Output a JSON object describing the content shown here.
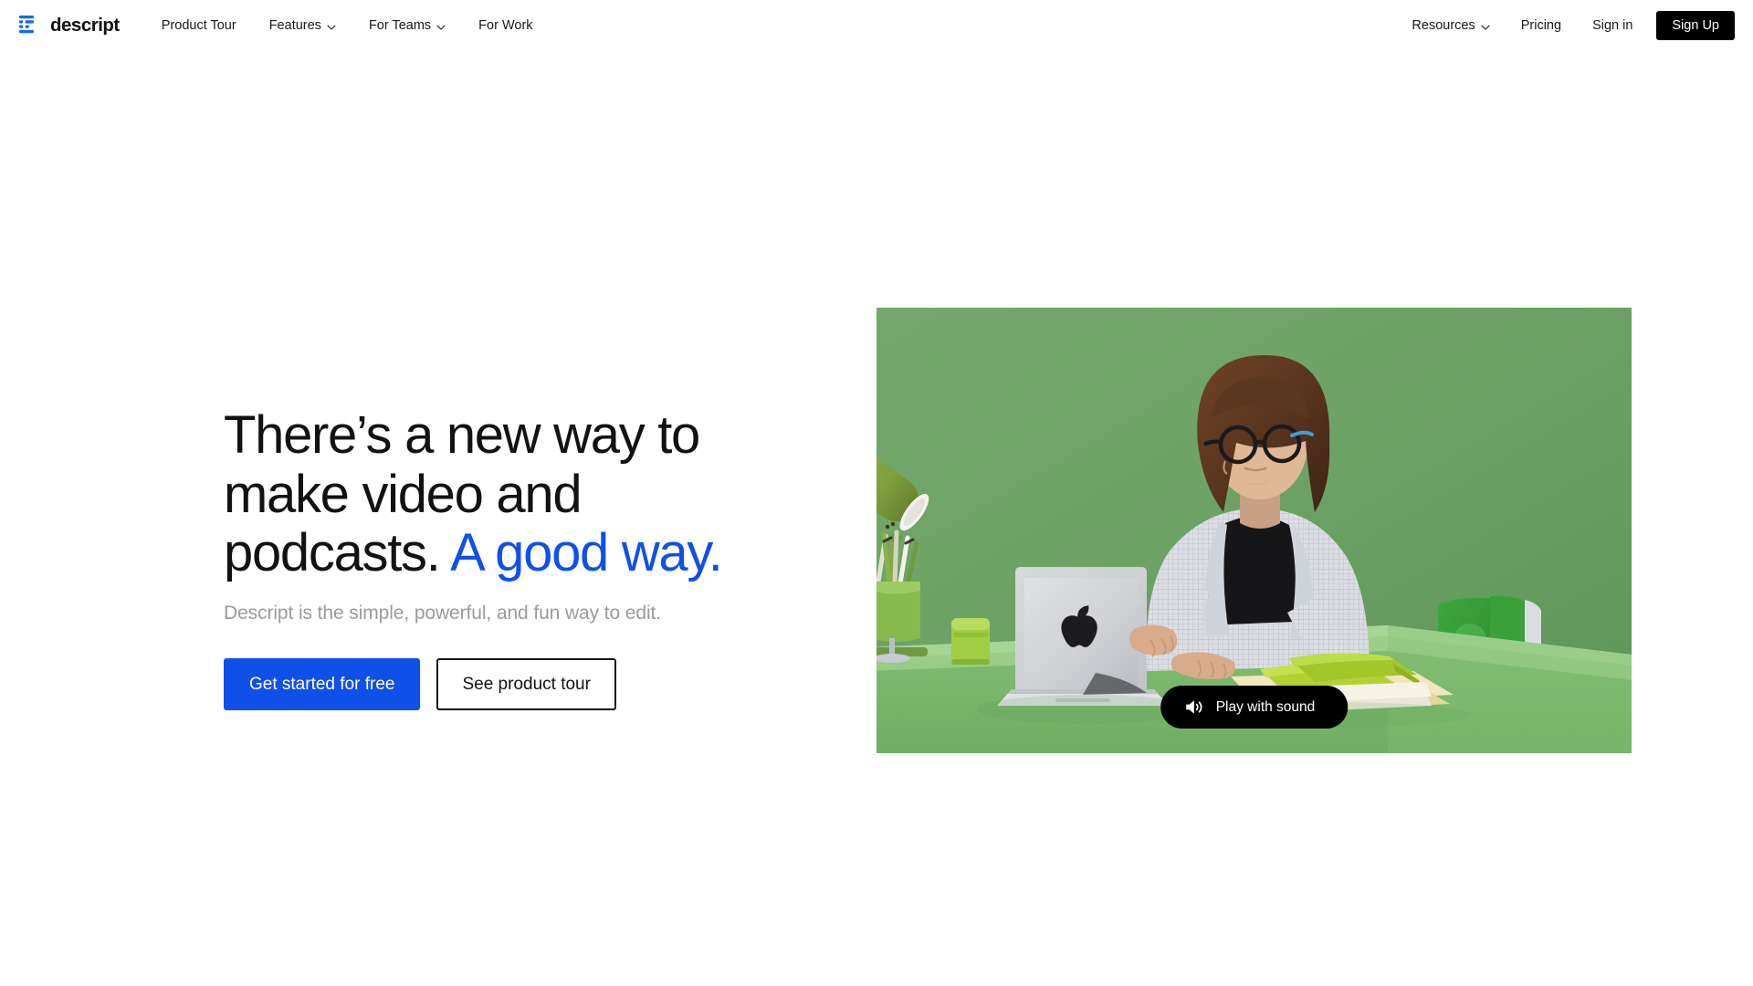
{
  "brand": {
    "name": "descript",
    "logo_icon": "descript-bars-logo",
    "logo_color": "#1668f0"
  },
  "nav": {
    "left_items": [
      {
        "label": "Product Tour",
        "has_dropdown": false,
        "icon": null
      },
      {
        "label": "Features",
        "has_dropdown": true,
        "icon": "chevron-down-icon"
      },
      {
        "label": "For Teams",
        "has_dropdown": true,
        "icon": "chevron-down-icon"
      },
      {
        "label": "For Work",
        "has_dropdown": false,
        "icon": null
      }
    ],
    "right_items": [
      {
        "label": "Resources",
        "has_dropdown": true,
        "icon": "chevron-down-icon"
      },
      {
        "label": "Pricing",
        "has_dropdown": false,
        "icon": null
      },
      {
        "label": "Sign in",
        "has_dropdown": false,
        "icon": null
      }
    ],
    "signup_label": "Sign Up",
    "signup_bg": "#000000"
  },
  "hero": {
    "headline_part1": "There’s a new way to make video and podcasts. ",
    "headline_accent": "A good way.",
    "accent_color": "#0f50e8",
    "subhead": "Descript is the simple, powerful, and fun way to edit.",
    "primary_cta": "Get started for free",
    "secondary_cta": "See product tour"
  },
  "video": {
    "sound_button_label": "Play with sound",
    "sound_button_icon": "speaker-volume-icon",
    "alt": "Woman with glasses working on a MacBook laptop at a green desk in a green-painted studio set with a green desk lamp, pencil cup, and green notebooks",
    "background_color": "#6fa368"
  }
}
